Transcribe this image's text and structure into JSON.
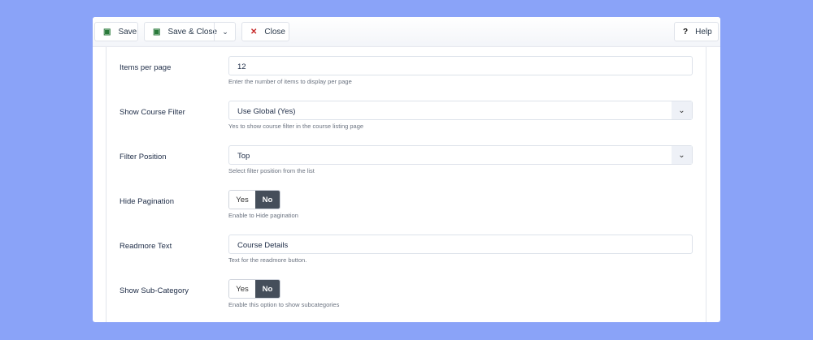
{
  "toolbar": {
    "save": "Save",
    "save_close": "Save & Close",
    "close": "Close",
    "help": "Help"
  },
  "fields": [
    {
      "label": "Items per page",
      "value": "12",
      "help": "Enter the number of items to display per page"
    },
    {
      "label": "Show Course Filter",
      "value": "Use Global (Yes)",
      "help": "Yes to show course filter in the course listing page"
    },
    {
      "label": "Filter Position",
      "value": "Top",
      "help": "Select filter position from the list"
    },
    {
      "label": "Hide Pagination",
      "yes": "Yes",
      "no": "No",
      "selected": "No",
      "help": "Enable to Hide pagination"
    },
    {
      "label": "Readmore Text",
      "value": "Course Details",
      "help": "Text for the readmore button."
    },
    {
      "label": "Show Sub-Category",
      "yes": "Yes",
      "no": "No",
      "selected": "No",
      "help": "Enable this option to show subcategories"
    }
  ]
}
